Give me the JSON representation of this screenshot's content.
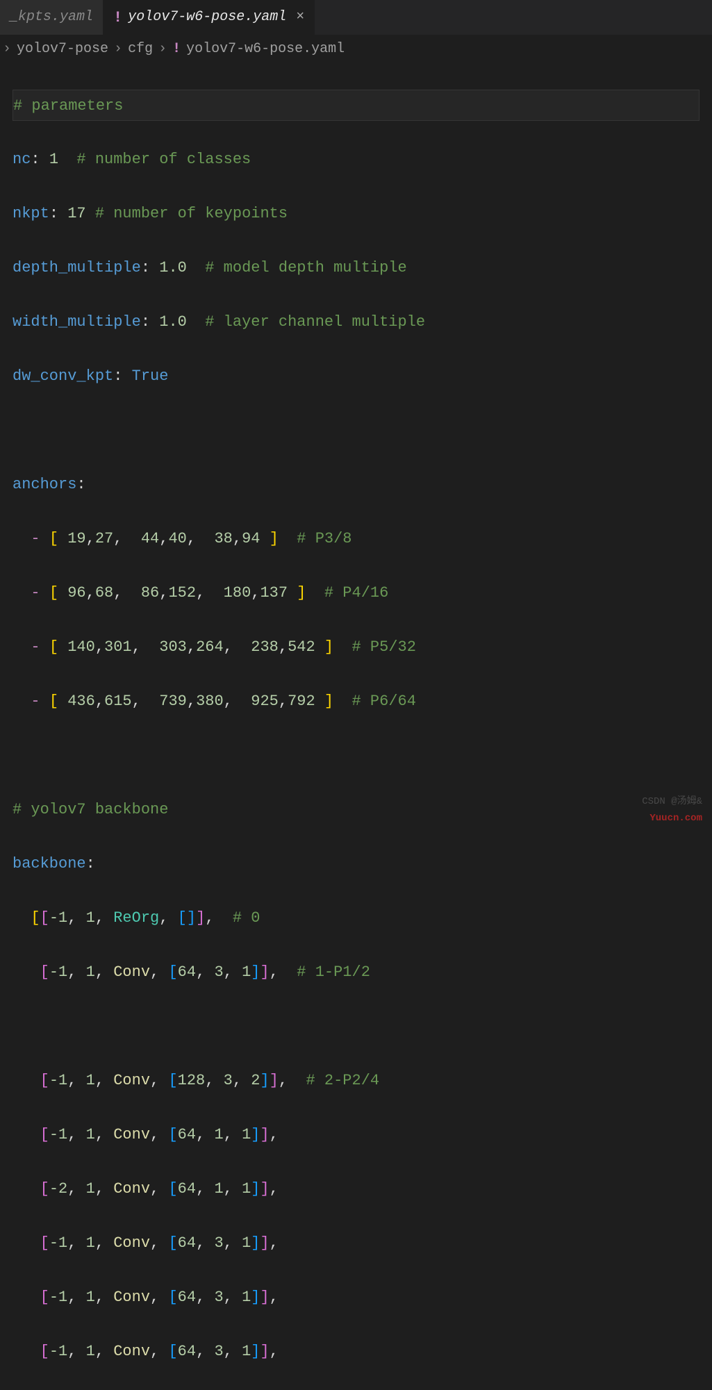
{
  "tabs": {
    "inactive": {
      "label": "_kpts.yaml"
    },
    "active": {
      "label": "yolov7-w6-pose.yaml",
      "close": "×"
    }
  },
  "breadcrumb": {
    "chev": "›",
    "seg1": "yolov7-pose",
    "seg2": "cfg",
    "seg3": "yolov7-w6-pose.yaml",
    "yaml_icon": "!"
  },
  "code": {
    "l1_comment": "# parameters",
    "l2_key": "nc",
    "l2_colon": ":",
    "l2_val": "1",
    "l2_comment": "# number of classes",
    "l3_key": "nkpt",
    "l3_colon": ":",
    "l3_val": "17",
    "l3_comment": "# number of keypoints",
    "l4_key": "depth_multiple",
    "l4_colon": ":",
    "l4_val": "1.0",
    "l4_comment": "# model depth multiple",
    "l5_key": "width_multiple",
    "l5_colon": ":",
    "l5_val": "1.0",
    "l5_comment": "# layer channel multiple",
    "l6_key": "dw_conv_kpt",
    "l6_colon": ":",
    "l6_val": "True",
    "l7_key": "anchors",
    "l7_colon": ":",
    "anchor_dash": "-",
    "a1": {
      "n1": "19",
      "n2": "27",
      "n3": "44",
      "n4": "40",
      "n5": "38",
      "n6": "94",
      "c": "# P3/8"
    },
    "a2": {
      "n1": "96",
      "n2": "68",
      "n3": "86",
      "n4": "152",
      "n5": "180",
      "n6": "137",
      "c": "# P4/16"
    },
    "a3": {
      "n1": "140",
      "n2": "301",
      "n3": "303",
      "n4": "264",
      "n5": "238",
      "n6": "542",
      "c": "# P5/32"
    },
    "a4": {
      "n1": "436",
      "n2": "615",
      "n3": "739",
      "n4": "380",
      "n5": "925",
      "n6": "792",
      "c": "# P6/64"
    },
    "l_backbone_c": "# yolov7 backbone",
    "l_backbone_k": "backbone",
    "l_backbone_colon": ":",
    "b1": {
      "neg1": "-1",
      "one": "1",
      "op": "ReOrg",
      "c": "# 0"
    },
    "b2": {
      "neg1": "-1",
      "one": "1",
      "op": "Conv",
      "p1": "64",
      "p2": "3",
      "p3": "1",
      "c": "# 1-P1/2"
    },
    "b3": {
      "neg1": "-1",
      "one": "1",
      "op": "Conv",
      "p1": "128",
      "p2": "3",
      "p3": "2",
      "c": "# 2-P2/4"
    },
    "b4": {
      "neg1": "-1",
      "one": "1",
      "op": "Conv",
      "p1": "64",
      "p2": "1",
      "p3": "1"
    },
    "b5": {
      "neg1": "-2",
      "one": "1",
      "op": "Conv",
      "p1": "64",
      "p2": "1",
      "p3": "1"
    },
    "b6": {
      "neg1": "-1",
      "one": "1",
      "op": "Conv",
      "p1": "64",
      "p2": "3",
      "p3": "1"
    },
    "b7": {
      "neg1": "-1",
      "one": "1",
      "op": "Conv",
      "p1": "64",
      "p2": "3",
      "p3": "1"
    },
    "b8": {
      "neg1": "-1",
      "one": "1",
      "op": "Conv",
      "p1": "64",
      "p2": "3",
      "p3": "1"
    },
    "comma": ",",
    "lbr": "[",
    "rbr": "]"
  },
  "watermark1": "CSDN @汤姆&",
  "watermark2": "Yuucn.com"
}
